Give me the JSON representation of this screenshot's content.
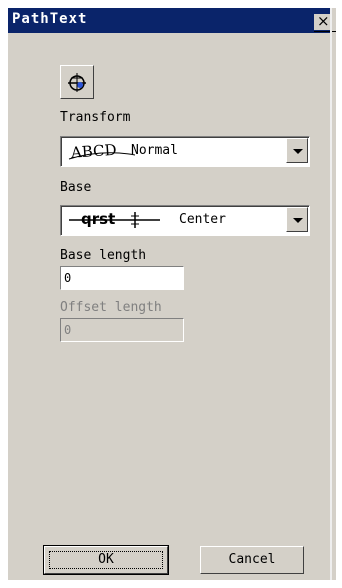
{
  "window": {
    "title": "PathText",
    "close_glyph": "×"
  },
  "toolbar": {
    "path_button_icon": "path-text-icon"
  },
  "transform": {
    "label": "Transform",
    "preview_text": "ABCD",
    "value": "Normal"
  },
  "base": {
    "label": "Base",
    "preview_text": "qrst",
    "value": "Center"
  },
  "base_length": {
    "label": "Base length",
    "value": "0"
  },
  "offset_length": {
    "label": "Offset length",
    "value": "0",
    "disabled": true
  },
  "buttons": {
    "ok": "OK",
    "cancel": "Cancel"
  },
  "colors": {
    "titlebar": "#0a246a",
    "face": "#d4d0c8",
    "disabled_text": "#808080"
  }
}
